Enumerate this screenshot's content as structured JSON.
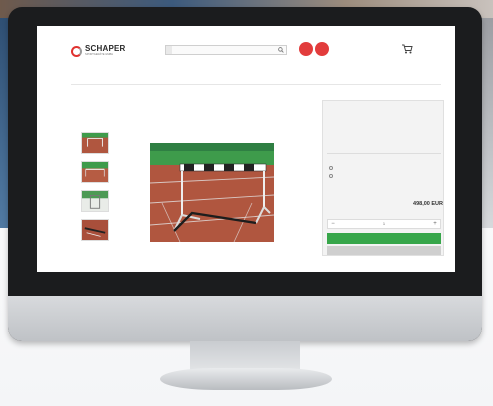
{
  "site": {
    "brand": "SCHAPER",
    "brand_sub": "SPORTGERÄTE GMBH",
    "top_links": [
      "",
      "",
      "",
      "",
      ""
    ],
    "search": {
      "select": "",
      "placeholder": ""
    },
    "badges": [
      "",
      ""
    ],
    "cart_text": "",
    "nav": [
      "",
      "",
      "",
      "",
      ""
    ]
  },
  "product": {
    "breadcrumb": "",
    "title_small": "",
    "panel_title": "",
    "sku_label": "",
    "sku_value": "",
    "options_title": "",
    "option_1": "",
    "option_2": "",
    "price": "498,00 EUR",
    "price_note": "",
    "quantity": "1",
    "add_to_cart": "",
    "wishlist": ""
  },
  "icons": {
    "search": "search-icon",
    "cart": "cart-icon",
    "minus": "minus-icon",
    "plus": "plus-icon"
  },
  "colors": {
    "brand_red": "#e0322f",
    "button_green": "#37a64a",
    "track": "#b0563f",
    "field_green": "#3e9b4b"
  }
}
